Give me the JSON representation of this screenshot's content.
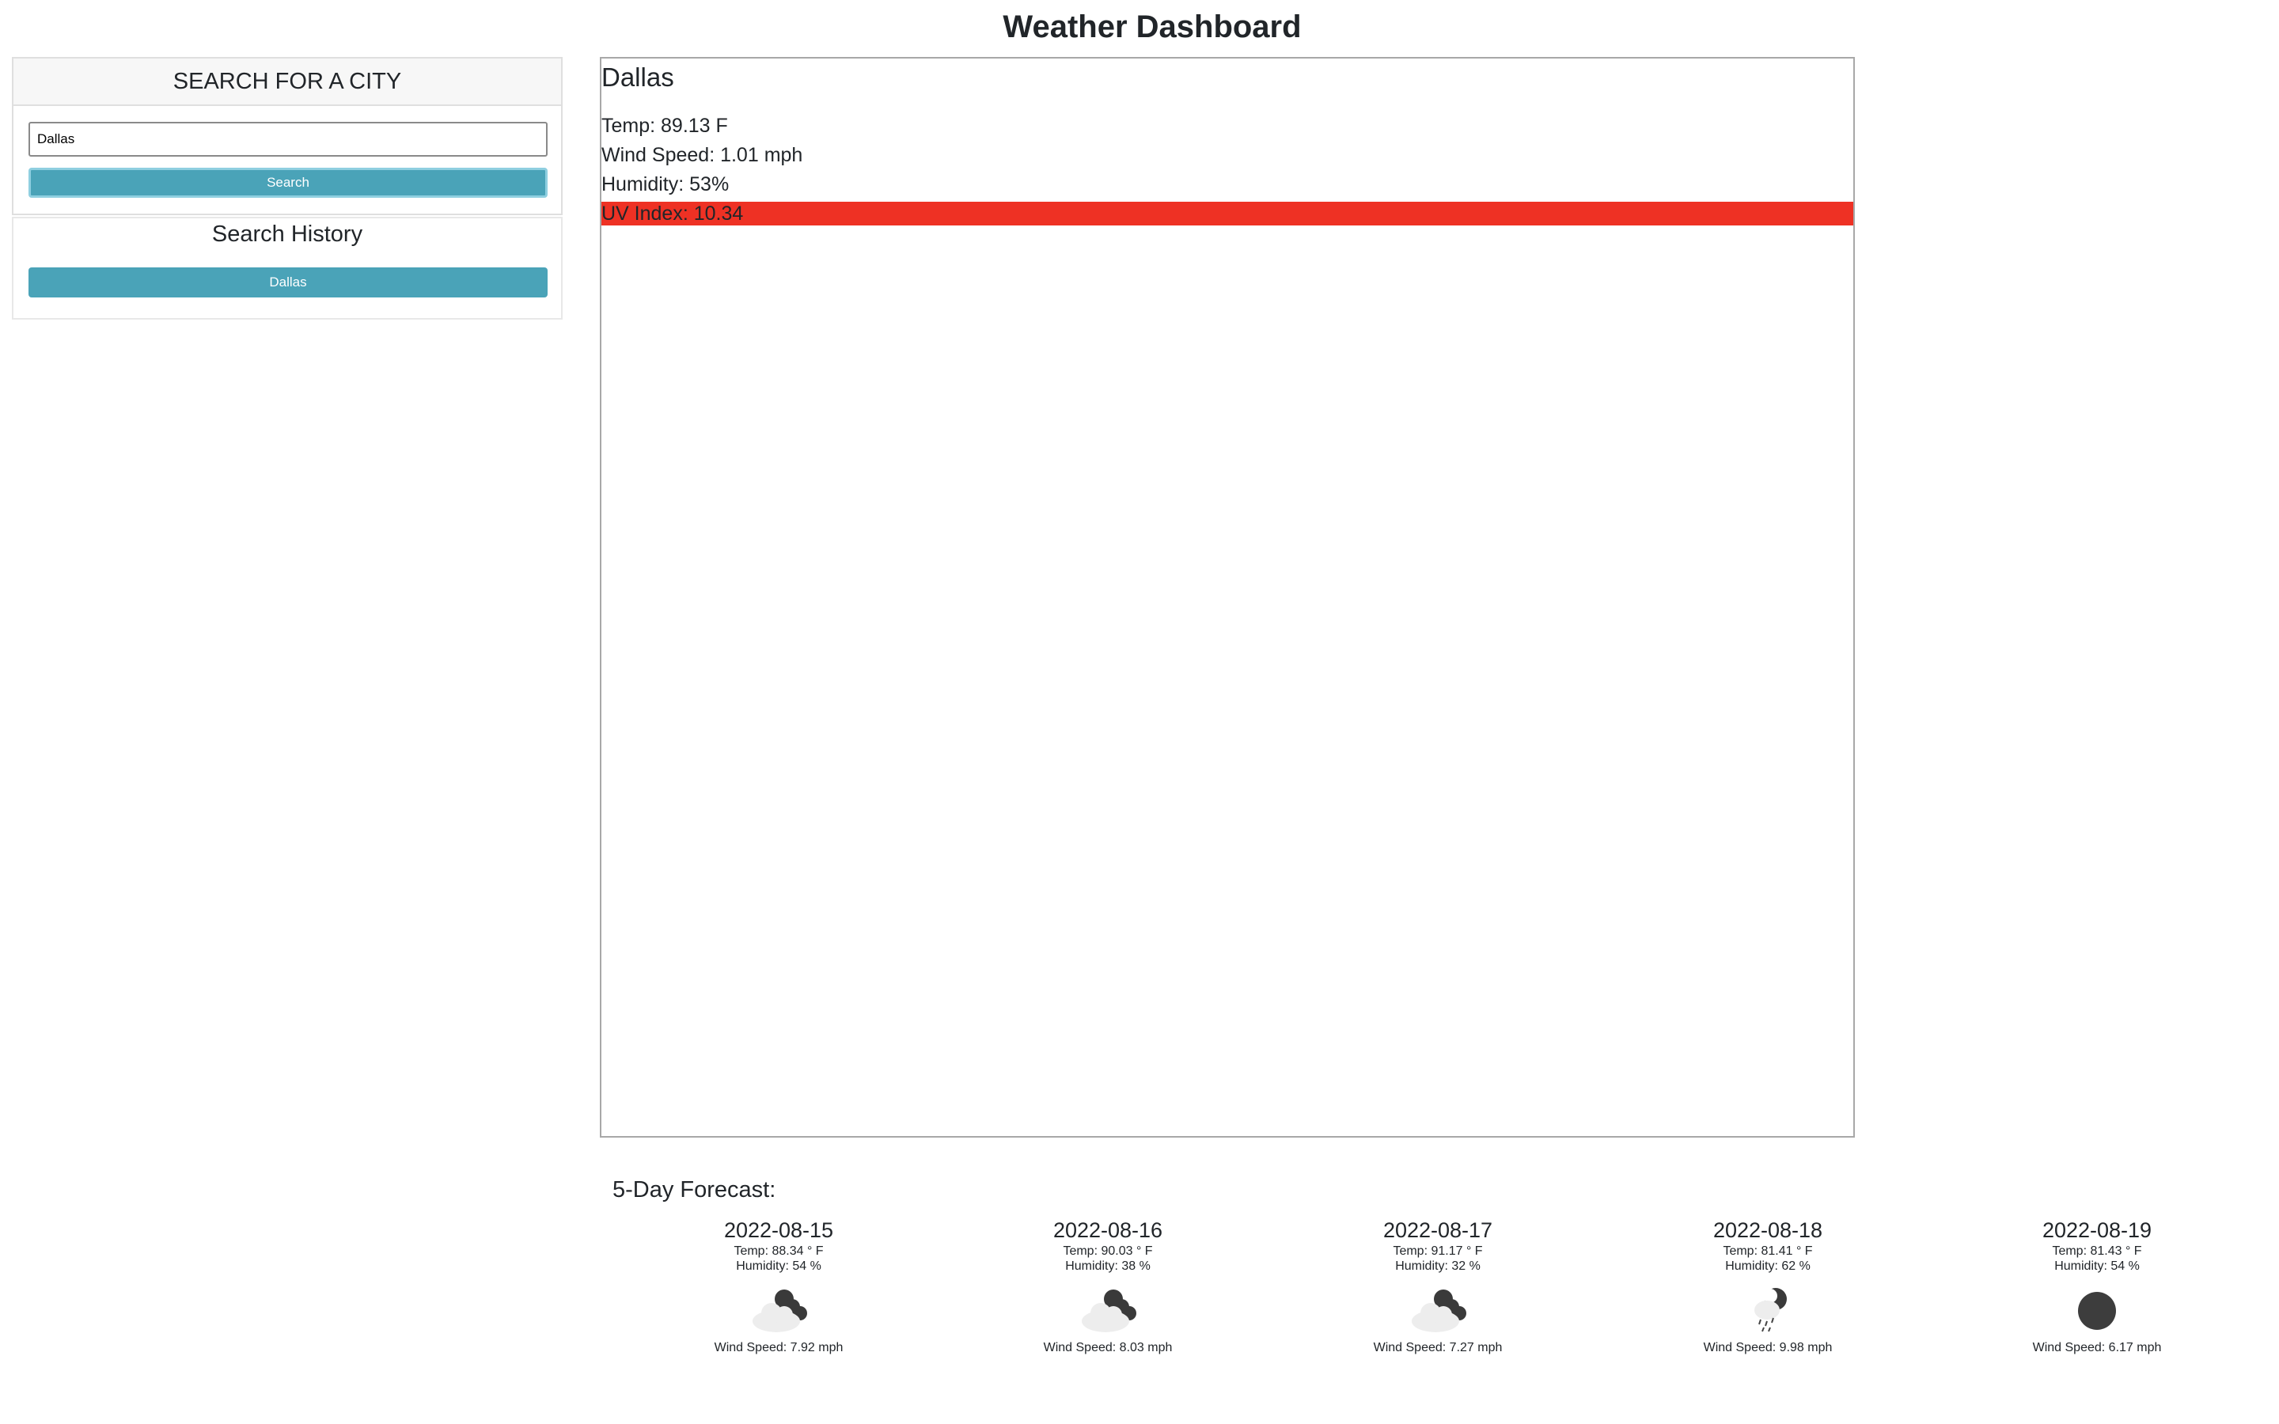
{
  "header": {
    "title": "Weather Dashboard"
  },
  "search": {
    "header": "SEARCH FOR A CITY",
    "input_value": "Dallas",
    "button_label": "Search"
  },
  "history": {
    "title": "Search History",
    "items": [
      {
        "label": "Dallas"
      }
    ]
  },
  "current": {
    "city": "Dallas",
    "temp": "Temp: 89.13 F",
    "wind": "Wind Speed: 1.01 mph",
    "humidity": "Humidity: 53%",
    "uv": "UV Index: 10.34",
    "uv_color": "#ee3124"
  },
  "forecast": {
    "heading": "5-Day Forecast:",
    "days": [
      {
        "date": "2022-08-15",
        "temp": "Temp: 88.34 ° F",
        "humidity": "Humidity: 54 %",
        "icon": "cloud-night-icon",
        "wind": "Wind Speed: 7.92 mph"
      },
      {
        "date": "2022-08-16",
        "temp": "Temp: 90.03 ° F",
        "humidity": "Humidity: 38 %",
        "icon": "cloud-night-icon",
        "wind": "Wind Speed: 8.03 mph"
      },
      {
        "date": "2022-08-17",
        "temp": "Temp: 91.17 ° F",
        "humidity": "Humidity: 32 %",
        "icon": "cloud-night-icon",
        "wind": "Wind Speed: 7.27 mph"
      },
      {
        "date": "2022-08-18",
        "temp": "Temp: 81.41 ° F",
        "humidity": "Humidity: 62 %",
        "icon": "rain-night-icon",
        "wind": "Wind Speed: 9.98 mph"
      },
      {
        "date": "2022-08-19",
        "temp": "Temp: 81.43 ° F",
        "humidity": "Humidity: 54 %",
        "icon": "clear-night-icon",
        "wind": "Wind Speed: 6.17 mph"
      }
    ]
  }
}
